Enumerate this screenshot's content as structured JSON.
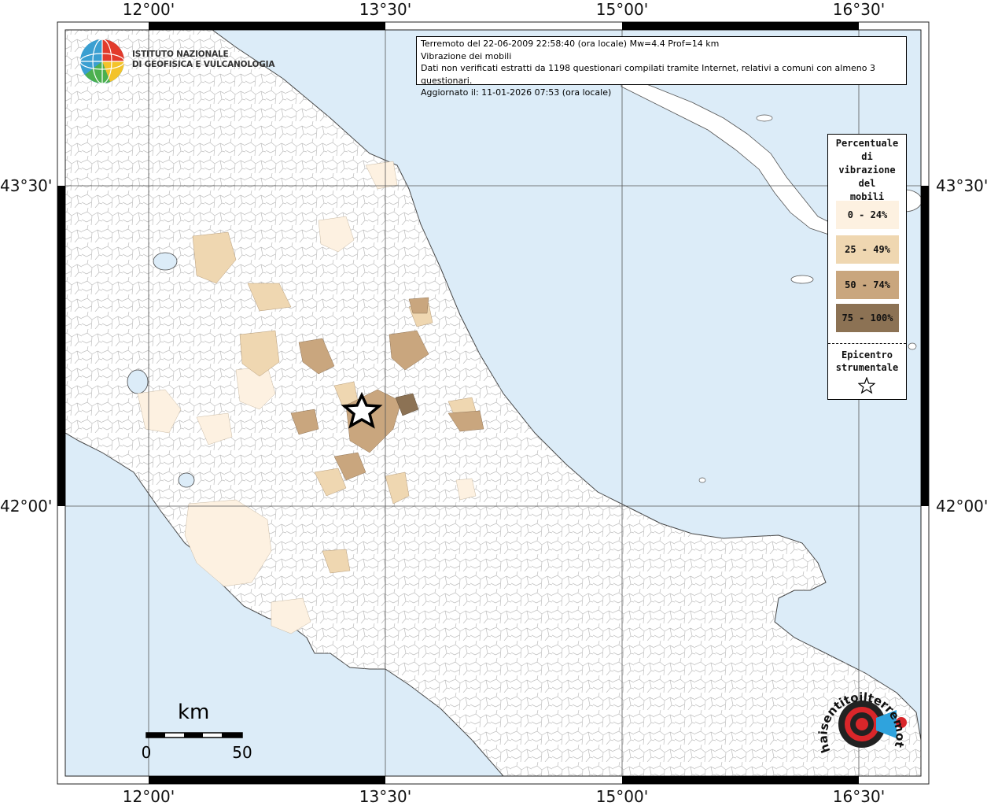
{
  "map": {
    "axes": {
      "lon_labels": [
        "12°00'",
        "13°30'",
        "15°00'",
        "16°30'"
      ],
      "lat_labels": [
        "43°30'",
        "42°00'"
      ]
    },
    "colors": {
      "sea": "#dcecf8",
      "land": "#ffffff",
      "borders": "#b8b8b8"
    }
  },
  "info": {
    "line1": "Terremoto del 22-06-2009 22:58:40 (ora locale) Mw=4.4 Prof=14 km",
    "line2": "Vibrazione dei mobili",
    "line3": "Dati non verificati estratti da 1198 questionari compilati tramite Internet, relativi a comuni con almeno 3 questionari.",
    "line4": "Aggiornato il: 11-01-2026 07:53 (ora locale)"
  },
  "logo": {
    "line1": "ISTITUTO NAZIONALE",
    "line2": "DI GEOFISICA E VULCANOLOGIA"
  },
  "legend": {
    "title": "Percentuale\ndi\nvibrazione\ndel\nmobili",
    "classes": [
      {
        "label": "0 - 24%",
        "color": "#fdf1e1"
      },
      {
        "label": "25 - 49%",
        "color": "#efd7b1"
      },
      {
        "label": "50 - 74%",
        "color": "#c9a67e"
      },
      {
        "label": "75 - 100%",
        "color": "#8c7254"
      }
    ],
    "epicenter_label": "Epicentro\nstrumentale",
    "epicenter_icon": "star-outline-icon"
  },
  "scale_bar": {
    "unit": "km",
    "min_label": "0",
    "max_label": "50"
  },
  "brand": {
    "text": "haisentitoilterremoto.it",
    "color": "#d9262a"
  }
}
